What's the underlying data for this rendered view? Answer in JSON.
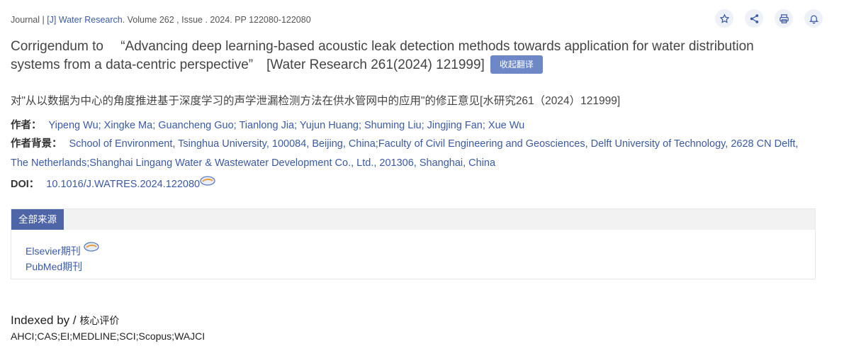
{
  "meta": {
    "prefix": "Journal | ",
    "journal": "[J] Water Research",
    "details": ". Volume 262 , Issue . 2024. PP 122080-122080"
  },
  "toolbar": {
    "icons": [
      "star-icon",
      "share-icon",
      "print-icon",
      "bell-icon"
    ]
  },
  "title": {
    "text": "Corrigendum to 　“Advancing deep learning-based acoustic leak detection methods towards application for water distribution systems from a data-centric perspective”　[Water Research 261(2024) 121999]",
    "translate_button": "收起翻译"
  },
  "title_cn": "对\"从以数据为中心的角度推进基于深度学习的声学泄漏检测方法在供水管网中的应用\"的修正意见[水研究261（2024）121999]",
  "authors": {
    "label": "作者：",
    "value": "Yipeng Wu; Xingke Ma; Guancheng Guo; Tianlong Jia; Yujun Huang; Shuming Liu; Jingjing Fan; Xue Wu"
  },
  "affiliation": {
    "label": "作者背景：",
    "value": "School of Environment, Tsinghua University, 100084, Beijing, China;Faculty of Civil Engineering and Geosciences, Delft University of Technology, 2628 CN Delft, The Netherlands;Shanghai Lingang Water & Wastewater Development Co., Ltd., 201306, Shanghai, China"
  },
  "doi": {
    "label": "DOI：",
    "value": "10.1016/J.WATRES.2024.122080"
  },
  "sources": {
    "tab": "全部来源",
    "items": [
      "Elsevier期刊",
      "PubMed期刊"
    ]
  },
  "indexed": {
    "label": "Indexed by / ",
    "label_cn": "核心评价",
    "list": "AHCI;CAS;EI;MEDLINE;SCI;Scopus;WAJCI"
  },
  "colors": {
    "link": "#3b5aa5",
    "tab": "#4e65a8",
    "translate": "#6e88c7"
  }
}
